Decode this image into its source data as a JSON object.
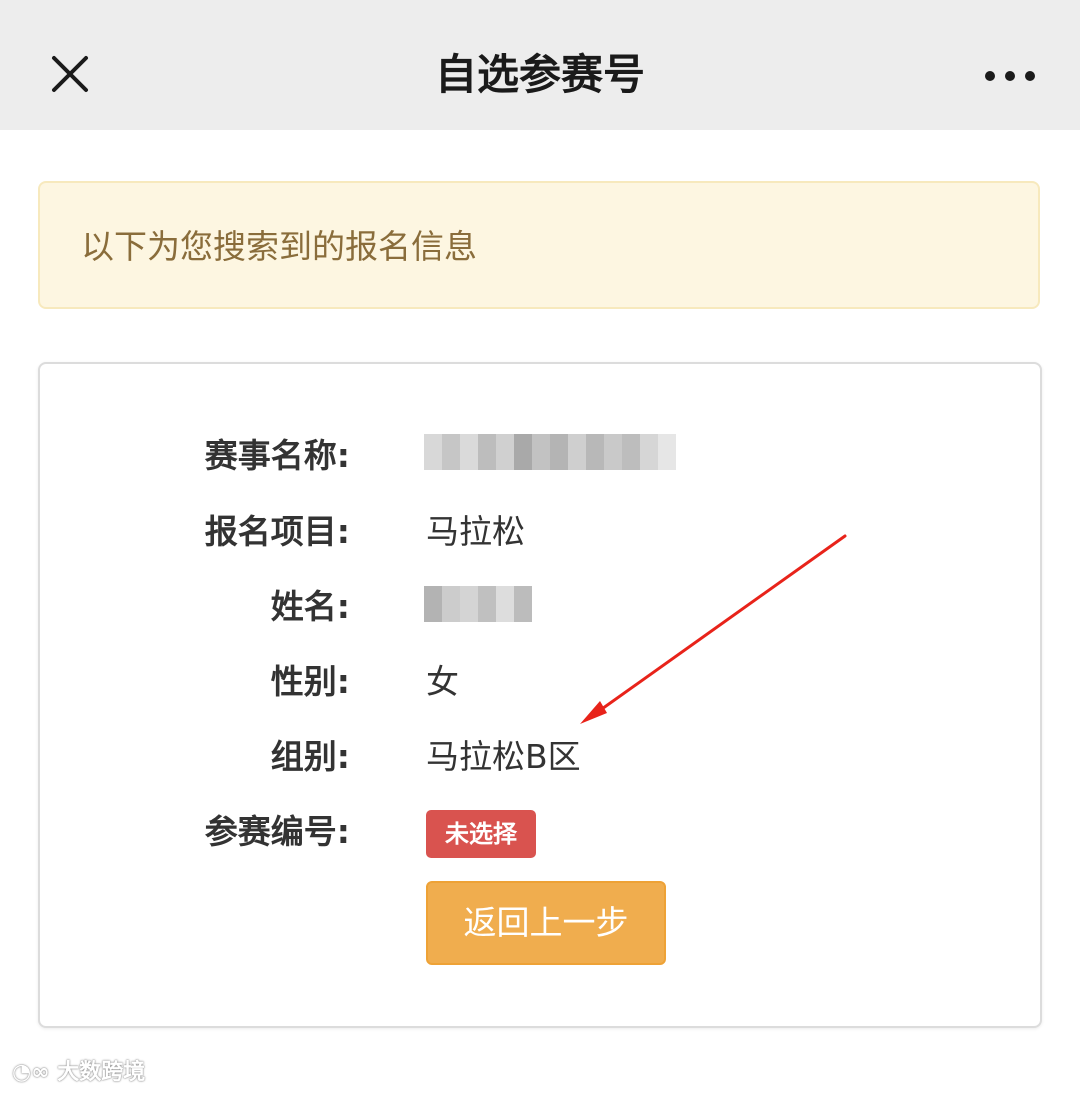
{
  "navbar": {
    "title": "自选参赛号",
    "close_icon": "close-icon",
    "more_icon": "more-icon"
  },
  "notice": {
    "text": "以下为您搜索到的报名信息"
  },
  "registration": {
    "event_name_label": "赛事名称:",
    "project_label": "报名项目:",
    "project_value": "马拉松",
    "name_label": "姓名:",
    "gender_label": "性别:",
    "gender_value": "女",
    "group_label": "组别:",
    "group_value": "马拉松B区",
    "bib_label": "参赛编号:",
    "bib_status": "未选择"
  },
  "actions": {
    "back_label": "返回上一步"
  },
  "watermark": {
    "text": "大数跨境"
  },
  "colors": {
    "navbar_bg": "#ededed",
    "notice_bg": "#fdf6e1",
    "notice_text": "#8a6d3b",
    "badge_bg": "#d9534f",
    "button_bg": "#f0ad4e",
    "annotation_arrow": "#e8231a"
  }
}
